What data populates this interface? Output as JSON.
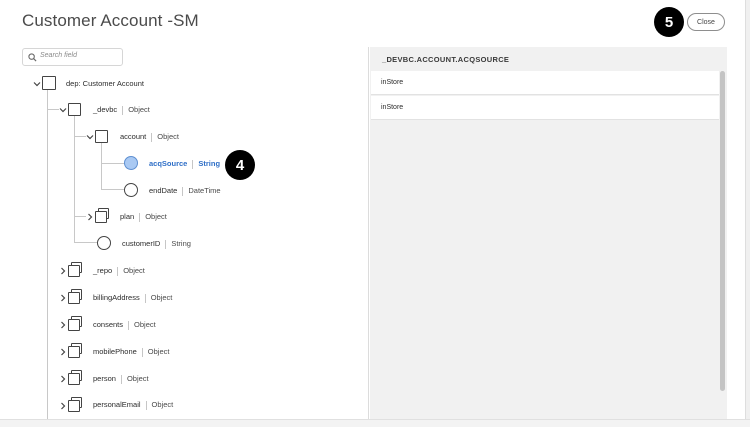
{
  "dialog": {
    "title": "Customer Account -SM",
    "close_label": "Close"
  },
  "annotations": {
    "badge_close": "5",
    "badge_field": "4"
  },
  "search": {
    "placeholder": "Search field"
  },
  "tree": {
    "root": {
      "name": "dep: Customer Account"
    },
    "devbc": {
      "name": "_devbc",
      "type": "Object"
    },
    "account": {
      "name": "account",
      "type": "Object"
    },
    "acqSource": {
      "name": "acqSource",
      "type": "String"
    },
    "endDate": {
      "name": "endDate",
      "type": "DateTime"
    },
    "plan": {
      "name": "plan",
      "type": "Object"
    },
    "customerID": {
      "name": "customerID",
      "type": "String"
    },
    "repo": {
      "name": "_repo",
      "type": "Object"
    },
    "billingAddress": {
      "name": "billingAddress",
      "type": "Object"
    },
    "consents": {
      "name": "consents",
      "type": "Object"
    },
    "mobilePhone": {
      "name": "mobilePhone",
      "type": "Object"
    },
    "person": {
      "name": "person",
      "type": "Object"
    },
    "personalEmail": {
      "name": "personalEmail",
      "type": "Object"
    }
  },
  "sample_panel": {
    "header": "_DEVBC.ACCOUNT.ACQSOURCE",
    "values": [
      "inStore",
      "inStore"
    ]
  },
  "colors": {
    "selected": "#2f6fc7",
    "selected_fill": "#a9c9f3"
  }
}
